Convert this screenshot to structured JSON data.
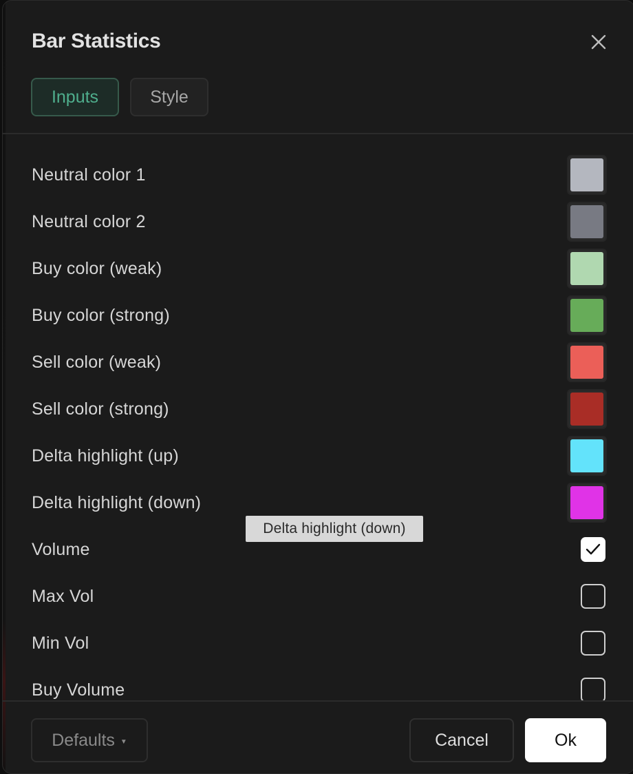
{
  "dialog": {
    "title": "Bar Statistics",
    "close_icon": "close-icon"
  },
  "tabs": [
    {
      "label": "Inputs",
      "active": true
    },
    {
      "label": "Style",
      "active": false
    }
  ],
  "inputs": {
    "colors": [
      {
        "label": "Neutral color 1",
        "color": "#b4b7bf"
      },
      {
        "label": "Neutral color 2",
        "color": "#787a83"
      },
      {
        "label": "Buy color (weak)",
        "color": "#b0d8b0"
      },
      {
        "label": "Buy color (strong)",
        "color": "#67ac59"
      },
      {
        "label": "Sell color (weak)",
        "color": "#eb5f58"
      },
      {
        "label": "Sell color (strong)",
        "color": "#a92d26"
      },
      {
        "label": "Delta highlight (up)",
        "color": "#63e3fb"
      },
      {
        "label": "Delta highlight (down)",
        "color": "#e033e7"
      }
    ],
    "checkboxes": [
      {
        "label": "Volume",
        "checked": true
      },
      {
        "label": "Max Vol",
        "checked": false
      },
      {
        "label": "Min Vol",
        "checked": false
      },
      {
        "label": "Buy Volume",
        "checked": false
      }
    ]
  },
  "tooltip": {
    "text": "Delta highlight (down)"
  },
  "footer": {
    "defaults_label": "Defaults",
    "cancel_label": "Cancel",
    "ok_label": "Ok"
  },
  "colors": {
    "accent": "#4fae8d",
    "background": "#1b1b1b"
  }
}
